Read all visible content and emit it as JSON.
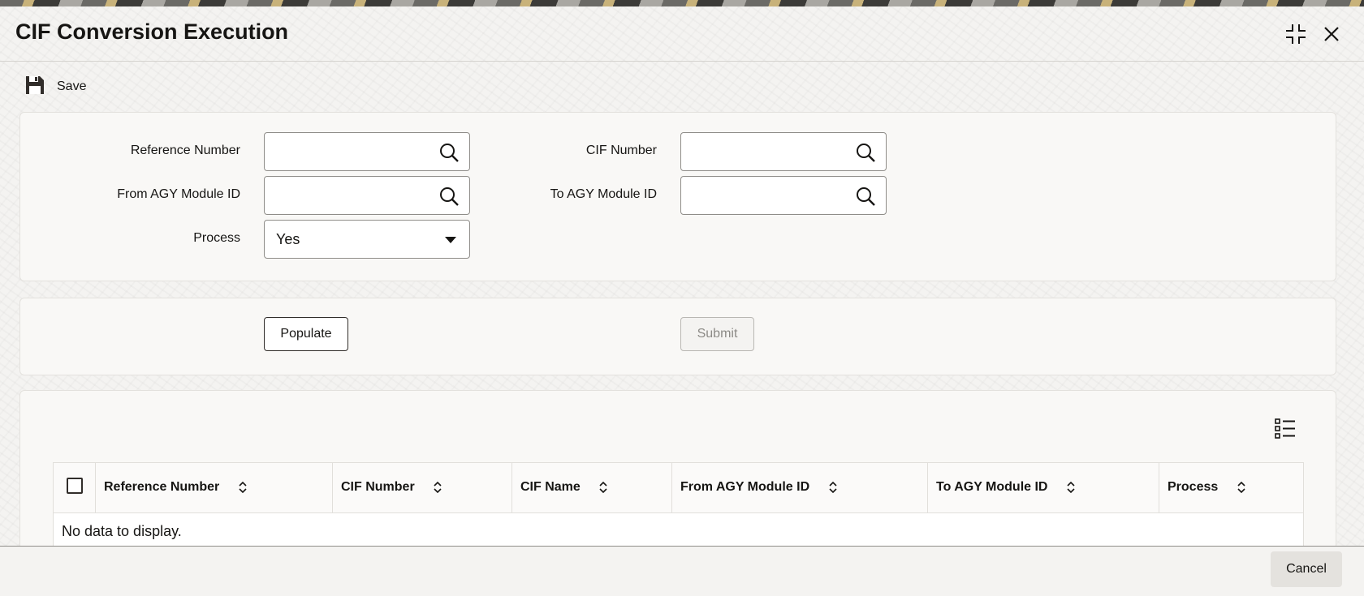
{
  "window": {
    "title": "CIF Conversion Execution",
    "maximize_icon": "maximize-icon",
    "close_icon": "close-icon"
  },
  "toolbar": {
    "save_label": "Save",
    "save_icon": "floppy-disk-icon"
  },
  "form": {
    "reference_number": {
      "label": "Reference Number",
      "value": ""
    },
    "cif_number": {
      "label": "CIF Number",
      "value": ""
    },
    "from_agy_module_id": {
      "label": "From AGY Module ID",
      "value": ""
    },
    "to_agy_module_id": {
      "label": "To AGY Module ID",
      "value": ""
    },
    "process": {
      "label": "Process",
      "value": "Yes"
    }
  },
  "actions": {
    "populate_label": "Populate",
    "submit_label": "Submit"
  },
  "grid": {
    "columns": [
      "Reference Number",
      "CIF Number",
      "CIF Name",
      "From AGY Module ID",
      "To AGY Module ID",
      "Process"
    ],
    "empty_message": "No data to display.",
    "settings_icon": "list-settings-icon"
  },
  "footer": {
    "cancel_label": "Cancel"
  },
  "colors": {
    "text": "#161513",
    "border": "#8f8d89",
    "panel_bg": "#f9f8f6",
    "page_bg": "#f4f3f1",
    "disabled_text": "#8c8a86"
  }
}
